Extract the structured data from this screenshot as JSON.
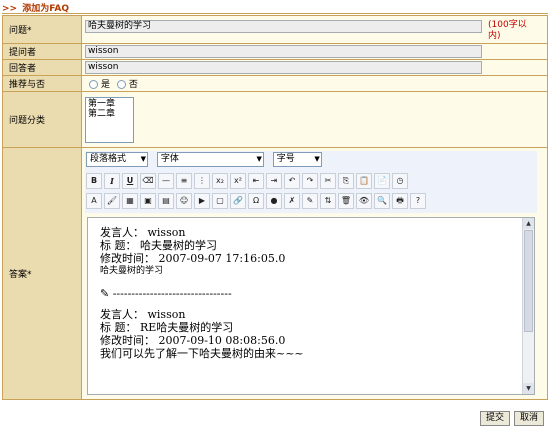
{
  "section_title": {
    "arrows": ">>",
    "text": "添加为FAQ"
  },
  "fields": {
    "question": {
      "label": "问题*",
      "value": "哈夫曼树的学习",
      "hint": "(100字以内)"
    },
    "asker": {
      "label": "提问者",
      "value": "wisson"
    },
    "answerer": {
      "label": "回答者",
      "value": "wisson"
    },
    "recommend": {
      "label": "推荐与否",
      "options": [
        "是",
        "否"
      ]
    },
    "category": {
      "label": "问题分类",
      "options": [
        "第一章",
        "第二章"
      ]
    },
    "answer": {
      "label": "答案*"
    }
  },
  "editor": {
    "paragraph_format": "段落格式",
    "font": "字体",
    "font_size": "字号",
    "row1_icons": [
      "bold-icon",
      "italic-icon",
      "underline-icon",
      "eraser-icon",
      "horizontal-rule-icon",
      "align-center-icon",
      "ordered-list-icon",
      "subscript-icon",
      "superscript-icon",
      "outdent-icon",
      "indent-icon",
      "undo-icon",
      "redo-icon",
      "cut-icon",
      "copy-icon",
      "paste-icon",
      "paste-text-icon",
      "timestamp-icon"
    ],
    "row1_text": [
      "B",
      "I",
      "U",
      "⌫",
      "—",
      "≡",
      "⋮",
      "x₂",
      "x²",
      "⇤",
      "⇥",
      "↶",
      "↷",
      "✂",
      "⎘",
      "📋",
      "📄",
      "◷"
    ],
    "row2_icons": [
      "font-color-icon",
      "highlight-icon",
      "table-icon",
      "image-icon",
      "flash-icon",
      "emoticon-icon",
      "media-icon",
      "frame-icon",
      "link-icon",
      "special-char-icon",
      "play-icon",
      "remove-format-icon",
      "edit-icon",
      "sort-icon",
      "delete-icon",
      "preview-icon",
      "find-icon",
      "print-icon",
      "help-icon"
    ],
    "row2_text": [
      "A",
      "🖌",
      "▦",
      "▣",
      "▤",
      "☺",
      "▶",
      "▢",
      "🔗",
      "Ω",
      "●",
      "✗",
      "✎",
      "⇅",
      "🗑",
      "👁",
      "🔍",
      "🖶",
      "?"
    ],
    "content": {
      "post1": {
        "speaker": "发言人：  wisson",
        "title": "标  题：  哈夫曼树的学习",
        "time": "修改时间：  2007-09-07 17:16:05.0",
        "body": "哈夫曼树的学习"
      },
      "divider_icon": "pencil-icon",
      "divider": "--------------------------------",
      "post2": {
        "speaker": "发言人：  wisson",
        "title": "标  题：  RE哈夫曼树的学习",
        "time": "修改时间：  2007-09-10 08:08:56.0",
        "body": "我们可以先了解一下哈夫曼树的由来~~~"
      }
    }
  },
  "buttons": {
    "submit": "提交",
    "cancel": "取消"
  }
}
